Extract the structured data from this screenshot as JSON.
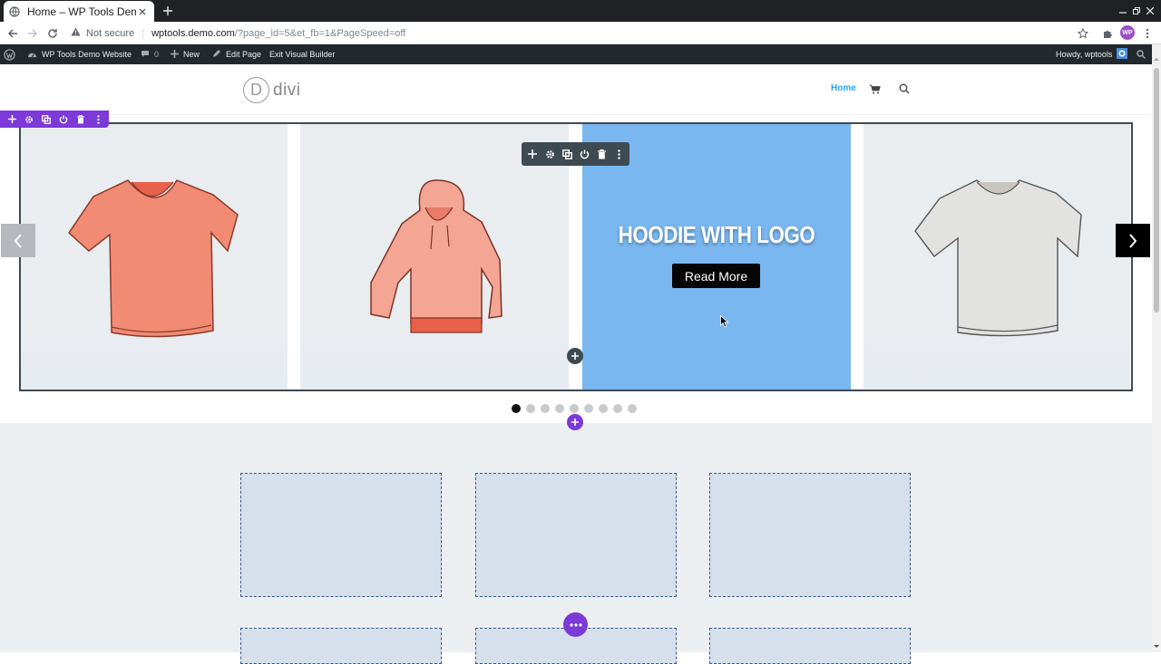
{
  "browser": {
    "tab_title": "Home – WP Tools Demo",
    "security_label": "Not secure",
    "url_host": "wptools.demo.com",
    "url_path": "/?page_id=5&et_fb=1&PageSpeed=off",
    "profile_initials": "WP"
  },
  "admin_bar": {
    "site_name": "WP Tools Demo Website",
    "comments_count": "0",
    "new_label": "New",
    "edit_page_label": "Edit Page",
    "exit_builder_label": "Exit Visual Builder",
    "greeting": "Howdy, wptools"
  },
  "site": {
    "logo_letter": "D",
    "logo_text": "divi",
    "menu_home": "Home"
  },
  "slider": {
    "active_slide_title": "HOODIE WITH LOGO",
    "active_slide_button": "Read More",
    "slides": [
      {
        "product": "v-neck t-shirt",
        "color": "coral"
      },
      {
        "product": "hoodie",
        "color": "coral"
      },
      {
        "product": "hoodie with logo",
        "color": "blue"
      },
      {
        "product": "t-shirt",
        "color": "grey"
      }
    ],
    "dot_count": 9,
    "active_dot": 0
  },
  "colors": {
    "builder_purple": "#7c3ad8",
    "toolbar_dark": "#3e4a52",
    "active_slide_bg": "#7ab7f0",
    "link_blue": "#2ea3f2",
    "placeholder_border": "#3d5a80"
  }
}
